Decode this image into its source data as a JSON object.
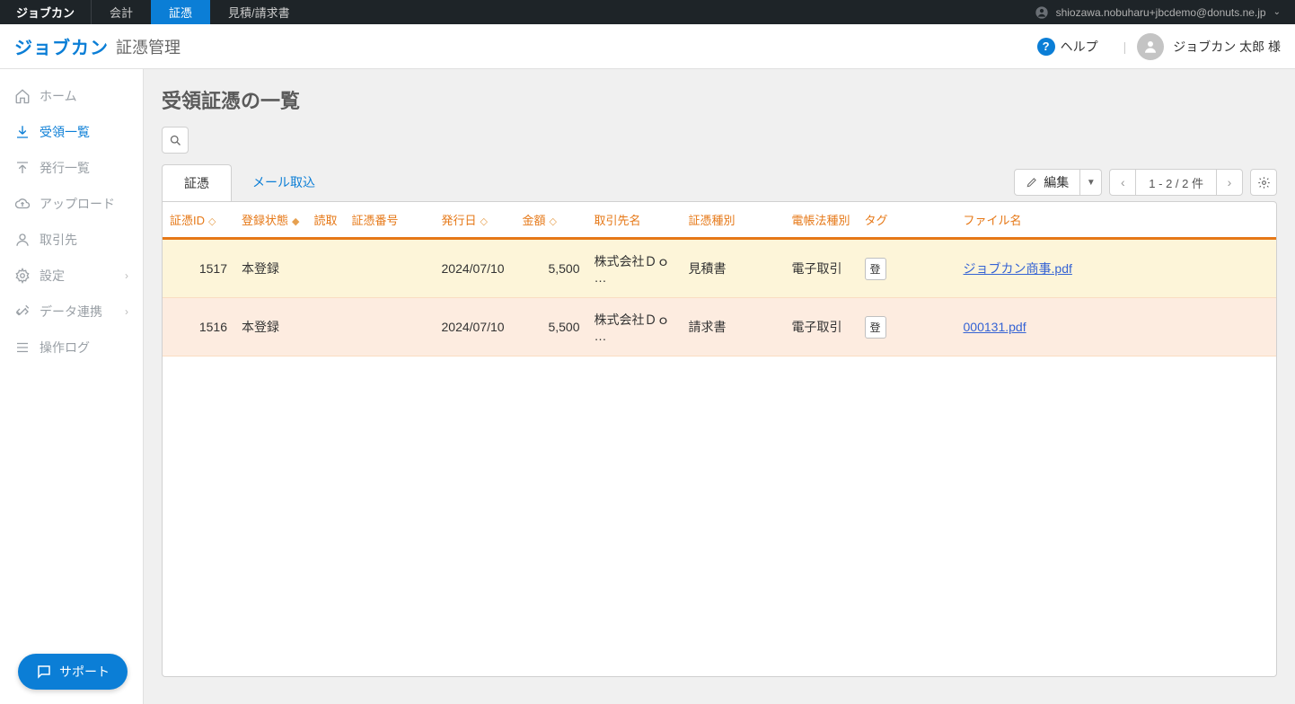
{
  "topbar": {
    "brand": "ジョブカン",
    "tabs": [
      "会計",
      "証憑",
      "見積/請求書"
    ],
    "active_tab": 1,
    "user_email": "shiozawa.nobuharu+jbcdemo@donuts.ne.jp"
  },
  "header": {
    "logo": "ジョブカン",
    "subtitle": "証憑管理",
    "help_label": "ヘルプ",
    "user_name": "ジョブカン 太郎 様"
  },
  "sidebar": {
    "items": [
      {
        "label": "ホーム",
        "icon": "home"
      },
      {
        "label": "受領一覧",
        "icon": "download",
        "active": true
      },
      {
        "label": "発行一覧",
        "icon": "upload"
      },
      {
        "label": "アップロード",
        "icon": "cloud"
      },
      {
        "label": "取引先",
        "icon": "person"
      },
      {
        "label": "設定",
        "icon": "gear",
        "chevron": true
      },
      {
        "label": "データ連携",
        "icon": "link",
        "chevron": true
      },
      {
        "label": "操作ログ",
        "icon": "list"
      }
    ]
  },
  "page": {
    "title": "受領証憑の一覧"
  },
  "tabs": {
    "items": [
      "証憑",
      "メール取込"
    ],
    "active": 0
  },
  "toolbar": {
    "edit_label": "編集",
    "pager_text": "1 - 2 / 2 件"
  },
  "table": {
    "headers": {
      "id": "証憑ID",
      "status": "登録状態",
      "read": "読取",
      "number": "証憑番号",
      "issue_date": "発行日",
      "amount": "金額",
      "partner": "取引先名",
      "type": "証憑種別",
      "law": "電帳法種別",
      "tag": "タグ",
      "file": "ファイル名"
    },
    "rows": [
      {
        "id": "1517",
        "status": "本登録",
        "read": "",
        "number": "",
        "issue_date": "2024/07/10",
        "amount": "5,500",
        "partner": "株式会社Ｄｏ …",
        "type": "見積書",
        "law": "電子取引",
        "tag": "登",
        "file": "ジョブカン商事.pdf"
      },
      {
        "id": "1516",
        "status": "本登録",
        "read": "",
        "number": "",
        "issue_date": "2024/07/10",
        "amount": "5,500",
        "partner": "株式会社Ｄｏ …",
        "type": "請求書",
        "law": "電子取引",
        "tag": "登",
        "file": "000131.pdf"
      }
    ]
  },
  "support": {
    "label": "サポート"
  }
}
